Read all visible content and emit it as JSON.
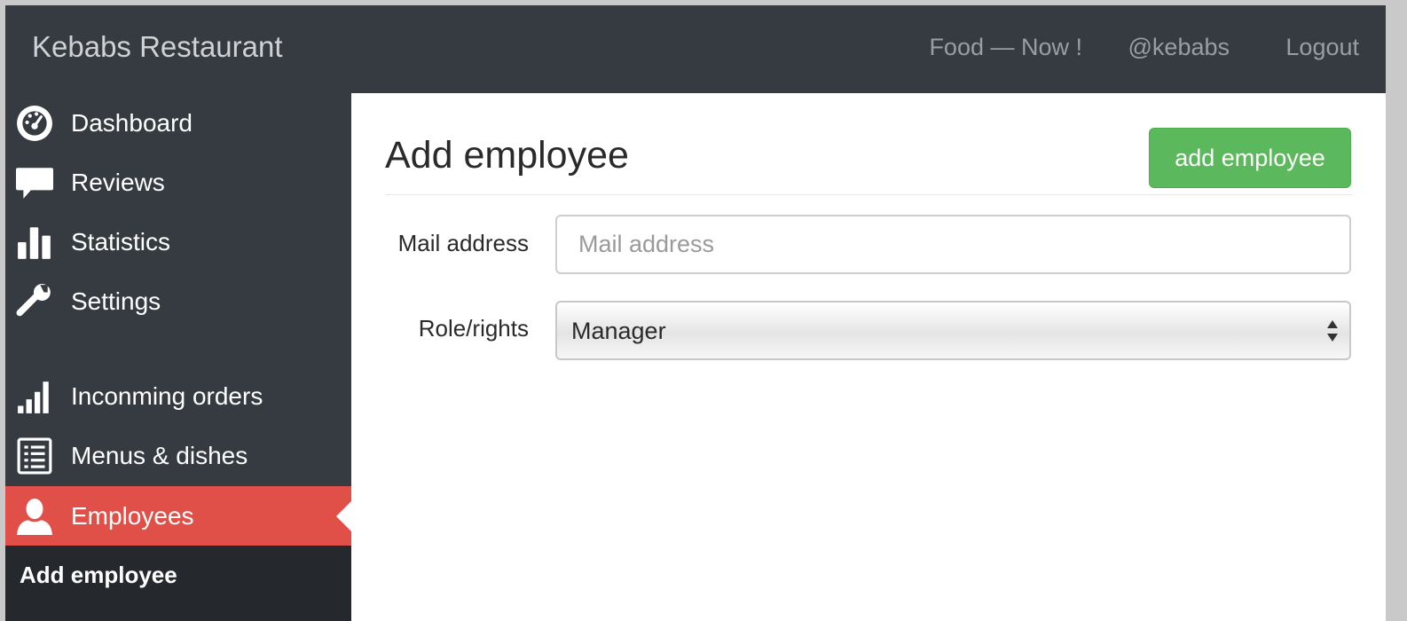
{
  "header": {
    "brand": "Kebabs Restaurant",
    "nav": {
      "food_now": "Food — Now !",
      "username": "@kebabs",
      "logout": "Logout"
    }
  },
  "sidebar": {
    "items": [
      {
        "label": "Dashboard",
        "icon": "dashboard-icon"
      },
      {
        "label": "Reviews",
        "icon": "speech-bubble-icon"
      },
      {
        "label": "Statistics",
        "icon": "bar-chart-icon"
      },
      {
        "label": "Settings",
        "icon": "wrench-icon"
      },
      {
        "label": "Inconming orders",
        "icon": "signal-bars-icon"
      },
      {
        "label": "Menus & dishes",
        "icon": "list-icon"
      },
      {
        "label": "Employees",
        "icon": "user-icon",
        "active": true
      }
    ],
    "sub_item": "Add employee"
  },
  "main": {
    "title": "Add employee",
    "add_button": "add employee",
    "form": {
      "mail_label": "Mail address",
      "mail_placeholder": "Mail address",
      "mail_value": "",
      "role_label": "Role/rights",
      "role_value": "Manager"
    }
  },
  "colors": {
    "topbar": "#363b41",
    "sidebar": "#363b41",
    "active": "#e05048",
    "subnav": "#25292d",
    "button": "#5cb85c"
  }
}
